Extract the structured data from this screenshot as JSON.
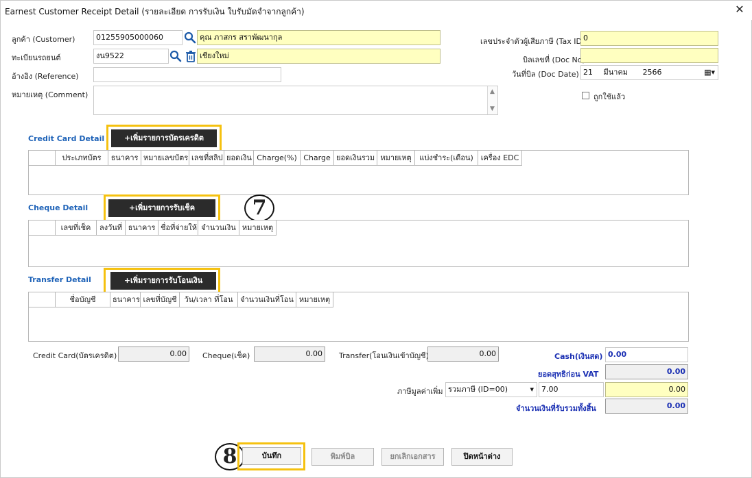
{
  "window": {
    "title": "Earnest Customer Receipt Detail (รายละเอียด การรับเงิน ใบรับมัดจำจากลูกค้า)"
  },
  "customer": {
    "label": "ลูกค้า (Customer)",
    "code": "01255905000060",
    "name": "คุณ ภาสกร สราพัฒนากุล"
  },
  "vehicle": {
    "label": "ทะเบียนรถยนต์",
    "plate": "งน9522",
    "province": "เชียงใหม่"
  },
  "reference": {
    "label": "อ้างอิง (Reference)",
    "value": ""
  },
  "comment": {
    "label": "หมายเหตุ (Comment)",
    "value": ""
  },
  "tax_id": {
    "label": "เลขประจำตัวผู้เสียภาษี (Tax ID)",
    "value": "0"
  },
  "doc_no": {
    "label": "บิลเลขที่ (Doc No)",
    "value": ""
  },
  "doc_date": {
    "label": "วันที่บิล (Doc Date)",
    "day": "21",
    "month": "มีนาคม",
    "year": "2566"
  },
  "used_checkbox": {
    "label": "ถูกใช้แล้ว",
    "checked": false
  },
  "credit_card": {
    "title": "Credit Card Detail",
    "add_button": "+เพิ่มรายการบัตรเครดิต",
    "columns": [
      "",
      "ประเภทบัตร",
      "ธนาคาร",
      "หมายเลขบัตร",
      "เลขที่สลิป",
      "ยอดเงิน",
      "Charge(%)",
      "Charge",
      "ยอดเงินรวม",
      "หมายเหตุ",
      "แบ่งชำระ(เดือน)",
      "เครื่อง EDC"
    ]
  },
  "cheque": {
    "title": "Cheque Detail",
    "add_button": "+เพิ่มรายการรับเช็ค",
    "columns": [
      "",
      "เลขที่เช็ค",
      "ลงวันที่",
      "ธนาคาร",
      "ชื่อที่จ่ายให้",
      "จำนวนเงิน",
      "หมายเหตุ"
    ]
  },
  "transfer": {
    "title": "Transfer Detail",
    "add_button": "+เพิ่มรายการรับโอนเงิน",
    "columns": [
      "",
      "ชื่อบัญชี",
      "ธนาคาร",
      "เลขที่บัญชี",
      "วัน/เวลา ที่โอน",
      "จำนวนเงินที่โอน",
      "หมายเหตุ"
    ]
  },
  "totals": {
    "credit_card_label": "Credit Card(บัตรเครดิต)",
    "credit_card_value": "0.00",
    "cheque_label": "Cheque(เช็ค)",
    "cheque_value": "0.00",
    "transfer_label": "Transfer(โอนเงินเข้าบัญชี)",
    "transfer_value": "0.00",
    "cash_label": "Cash(เงินสด)",
    "cash_value": "0.00",
    "net_label": "ยอดสุทธิก่อน VAT",
    "net_value": "0.00",
    "vat_label": "ภาษีมูลค่าเพิ่ม",
    "vat_type": "รวมภาษี (ID=00)",
    "vat_rate": "7.00",
    "vat_value": "0.00",
    "grand_label": "จำนวนเงินที่รับรวมทั้งสิ้น",
    "grand_value": "0.00"
  },
  "annotations": {
    "step7": "7",
    "step8": "8"
  },
  "buttons": {
    "save": "บันทึก",
    "print": "พิมพ์บิล",
    "cancel_doc": "ยกเลิกเอกสาร",
    "close": "ปิดหน้าต่าง"
  },
  "colors": {
    "highlight": "#f5c10f",
    "section_title": "#1f63b8",
    "yellow_field": "#ffffc0",
    "dark_button": "#2b2b2b"
  }
}
